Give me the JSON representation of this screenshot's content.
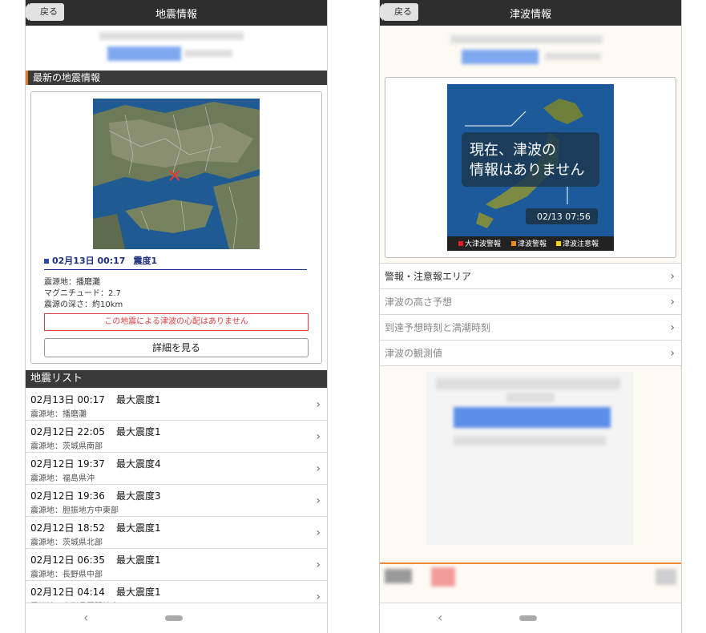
{
  "left_screen": {
    "header": {
      "back_label": "戻る",
      "title": "地震情報"
    },
    "latest_section": {
      "heading": "最新の地震情報"
    },
    "latest": {
      "date_time": "02月13日 00:17",
      "intensity": "震度1",
      "epicenter": "震源地：播磨灘",
      "magnitude": "マグニチュード：2.7",
      "depth": "震源の深さ：約10km",
      "tsunami_note": "この地震による津波の心配はありません",
      "detail_button": "詳細を見る"
    },
    "list_heading": "地震リスト",
    "quakes": [
      {
        "time": "02月13日 00:17",
        "max": "最大震度1",
        "place": "震源地：播磨灘"
      },
      {
        "time": "02月12日 22:05",
        "max": "最大震度1",
        "place": "震源地：茨城県南部"
      },
      {
        "time": "02月12日 19:37",
        "max": "最大震度4",
        "place": "震源地：福島県沖"
      },
      {
        "time": "02月12日 19:36",
        "max": "最大震度3",
        "place": "震源地：胆振地方中東部"
      },
      {
        "time": "02月12日 18:52",
        "max": "最大震度1",
        "place": "震源地：茨城県北部"
      },
      {
        "time": "02月12日 06:35",
        "max": "最大震度1",
        "place": "震源地：長野県中部"
      },
      {
        "time": "02月12日 04:14",
        "max": "最大震度1",
        "place": "震源地：山形県置賜地方"
      }
    ],
    "nav": {
      "back_glyph": "‹"
    }
  },
  "right_screen": {
    "header": {
      "back_label": "戻る",
      "title": "津波情報"
    },
    "tsunami_map": {
      "message_line1": "現在、津波の",
      "message_line2": "情報はありません",
      "timestamp": "02/13 07:56",
      "legend": [
        {
          "label": "大津波警報",
          "color": "#e02020"
        },
        {
          "label": "津波警報",
          "color": "#f08c1e"
        },
        {
          "label": "津波注意報",
          "color": "#f2d21b"
        }
      ]
    },
    "menu": [
      {
        "label": "警報・注意報エリア",
        "active": true
      },
      {
        "label": "津波の高さ予想",
        "active": false
      },
      {
        "label": "到達予想時刻と満潮時刻",
        "active": false
      },
      {
        "label": "津波の観測値",
        "active": false
      }
    ],
    "nav": {
      "back_glyph": "‹"
    }
  },
  "colors": {
    "header_bg": "#2e2e2e",
    "accent_orange": "#f08a3a",
    "quake_blue": "#1e2f7c",
    "alert_red": "#e23b3b"
  }
}
